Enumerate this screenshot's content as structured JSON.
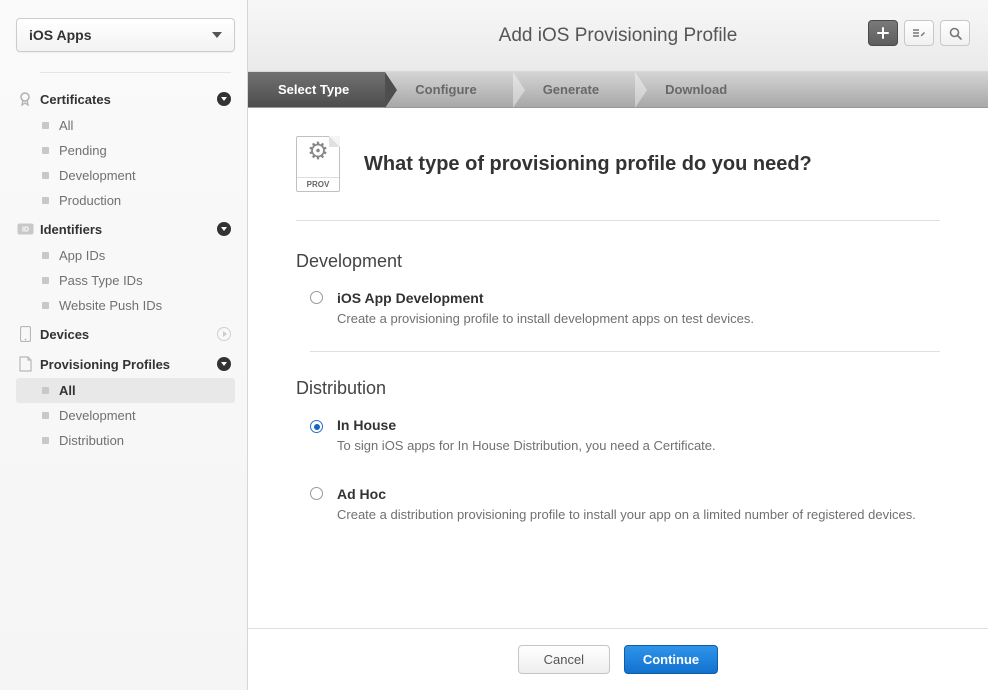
{
  "sidebar": {
    "dropdown_label": "iOS Apps",
    "sections": [
      {
        "title": "Certificates",
        "items": [
          {
            "label": "All"
          },
          {
            "label": "Pending"
          },
          {
            "label": "Development"
          },
          {
            "label": "Production"
          }
        ]
      },
      {
        "title": "Identifiers",
        "items": [
          {
            "label": "App IDs"
          },
          {
            "label": "Pass Type IDs"
          },
          {
            "label": "Website Push IDs"
          }
        ]
      },
      {
        "title": "Devices"
      },
      {
        "title": "Provisioning Profiles",
        "items": [
          {
            "label": "All"
          },
          {
            "label": "Development"
          },
          {
            "label": "Distribution"
          }
        ]
      }
    ]
  },
  "header": {
    "page_title": "Add iOS Provisioning Profile"
  },
  "steps": [
    "Select Type",
    "Configure",
    "Generate",
    "Download"
  ],
  "content": {
    "prov_icon_tag": "PROV",
    "heading": "What type of provisioning profile do you need?",
    "groups": [
      {
        "title": "Development",
        "options": [
          {
            "label": "iOS App Development",
            "desc": "Create a provisioning profile to install development apps on test devices."
          }
        ]
      },
      {
        "title": "Distribution",
        "options": [
          {
            "label": "In House",
            "desc": "To sign iOS apps for In House Distribution, you need a Certificate."
          },
          {
            "label": "Ad Hoc",
            "desc": "Create a distribution provisioning profile to install your app on a limited number of registered devices."
          }
        ]
      }
    ]
  },
  "footer": {
    "cancel": "Cancel",
    "continue": "Continue"
  }
}
